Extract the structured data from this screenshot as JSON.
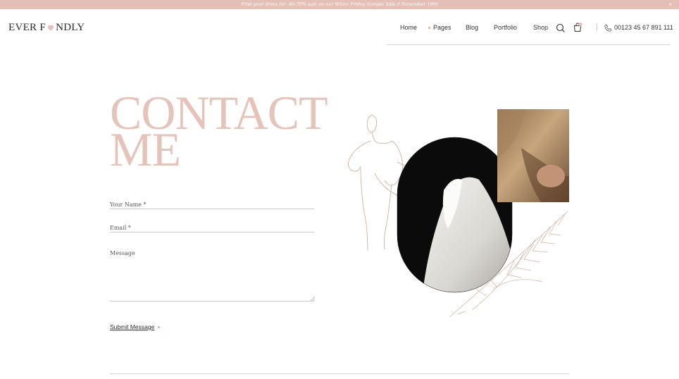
{
  "announcement": {
    "text": "Find your dress for -40-70% sale on our White Friday Sample Sale // November 19th",
    "close_label": "×"
  },
  "header": {
    "logo": {
      "left": "EVER F",
      "right": "NDLY"
    },
    "nav": [
      {
        "label": "Home"
      },
      {
        "label": "Pages"
      },
      {
        "label": "Blog"
      },
      {
        "label": "Portfolio"
      },
      {
        "label": "Shop"
      }
    ],
    "cart_count": "0",
    "phone": "00123 45 67 891 111"
  },
  "contact": {
    "title_line1": "CONTACT",
    "title_line2": "ME",
    "fields": {
      "name_label": "Your Name *",
      "email_label": "Email *",
      "message_label": "Message"
    },
    "submit_label": "Submit Message"
  },
  "colors": {
    "accent": "#e3bfb6",
    "title": "#e5c3b8",
    "dot": "#e3a69a"
  }
}
